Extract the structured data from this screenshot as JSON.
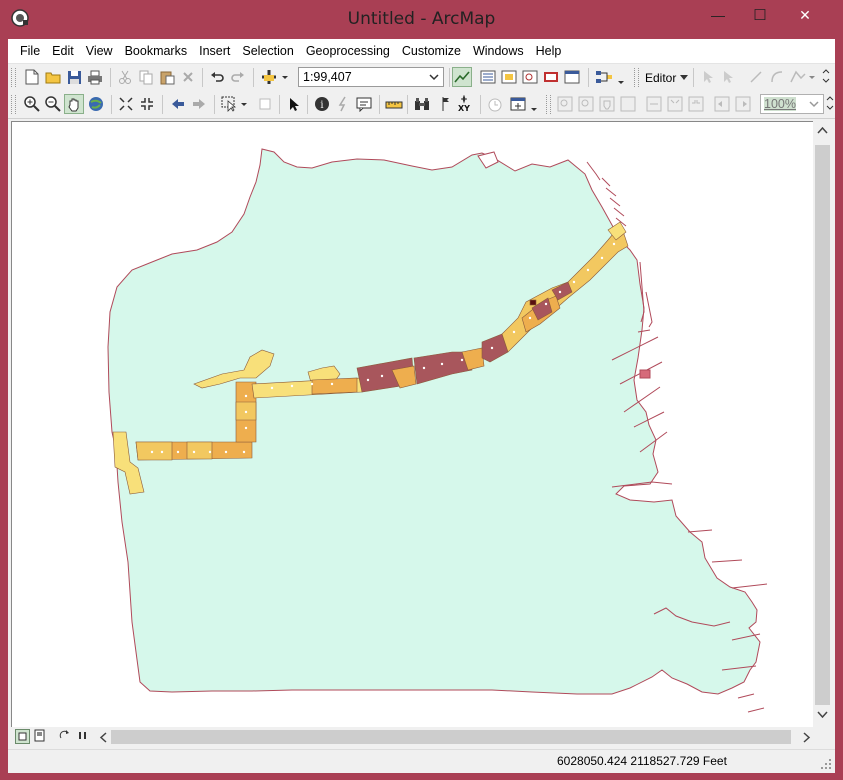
{
  "window": {
    "title": "Untitled - ArcMap",
    "controls": {
      "minimize": "—",
      "maximize": "☐",
      "close": "✕"
    }
  },
  "menu": [
    "File",
    "Edit",
    "View",
    "Bookmarks",
    "Insert",
    "Selection",
    "Geoprocessing",
    "Customize",
    "Windows",
    "Help"
  ],
  "toolbar": {
    "scale": "1:99,407",
    "editor_label": "Editor",
    "zoom_percent": "100%"
  },
  "map": {
    "land_color": "#d6f8eb",
    "outline_color": "#b04a5a",
    "parcel_colors": [
      "#f8e07a",
      "#eeae4e",
      "#a8565c",
      "#f2c860",
      "#5a1010"
    ]
  },
  "status": {
    "coordinates": "6028050.424  2118527.729 Feet"
  },
  "icons": [
    "new-document-icon",
    "open-folder-icon",
    "save-icon",
    "print-icon",
    "cut-icon",
    "copy-icon",
    "paste-icon",
    "delete-icon",
    "undo-icon",
    "redo-icon",
    "add-data-icon",
    "zoom-in-icon",
    "zoom-out-icon",
    "pan-icon",
    "full-extent-icon",
    "select-icon",
    "identify-icon",
    "find-icon",
    "go-to-xy-icon",
    "layout-view-icon",
    "data-view-icon",
    "refresh-icon",
    "pause-icon"
  ]
}
